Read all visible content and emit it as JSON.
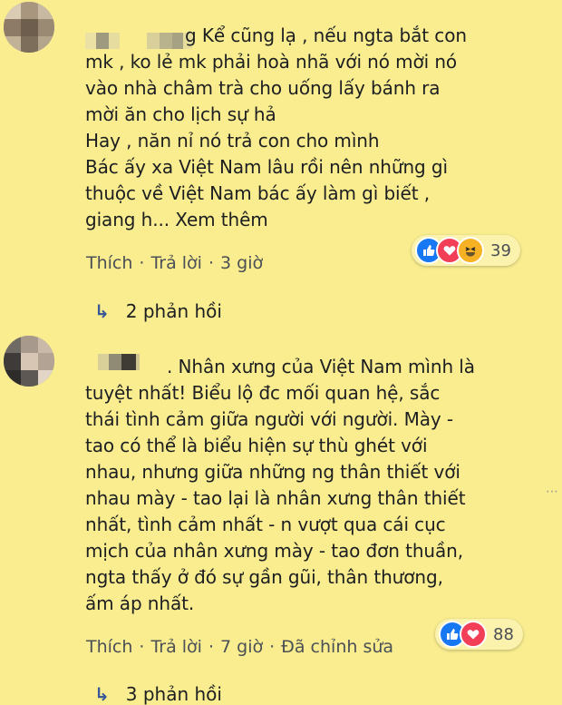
{
  "comments": [
    {
      "text": "g Kể cũng lạ , nếu ngta bắt con\nmk , ko lẻ mk phải hoà nhã với nó mời nó\nvào nhà châm trà cho uống lấy bánh ra\nmời ăn cho lịch sự hả\nHay , năn nỉ nó trả con cho mình\nBác ấy xa Việt Nam lâu rồi nên những gì\nthuộc về Việt Nam bác ấy làm gì biết ,\ngiang h... Xem thêm",
      "actions": {
        "like": "Thích",
        "reply": "Trả lời",
        "time": "3 giờ"
      },
      "reaction_count": "39",
      "reactions": [
        "like-icon",
        "love-icon",
        "haha-icon"
      ],
      "replies_label": "2 phản hồi"
    },
    {
      "text": ". Nhân xưng của Việt Nam mình là\ntuyệt nhất! Biểu lộ đc mối quan hệ, sắc\nthái tình cảm giữa người với người. Mày -\ntao có thể là biểu hiện sự thù ghét với\nnhau, nhưng giữa những ng thân thiết với\nnhau mày - tao lại là nhân xưng thân thiết\nnhất, tình cảm nhất - n vượt qua cái cục\nmịch của nhân xưng mày - tao đơn thuần,\nngta thấy ở đó sự gần gũi, thân thương,\nấm áp nhất.",
      "actions": {
        "like": "Thích",
        "reply": "Trả lời",
        "time": "7 giờ",
        "edited": "Đã chỉnh sửa"
      },
      "reaction_count": "88",
      "reactions": [
        "like-icon",
        "love-icon"
      ],
      "replies_label": "3 phản hồi"
    }
  ],
  "colors": {
    "background": "#f9ed8f",
    "link": "#385898",
    "like": "#1877f2",
    "love": "#f33e58",
    "haha": "#f7b125"
  }
}
